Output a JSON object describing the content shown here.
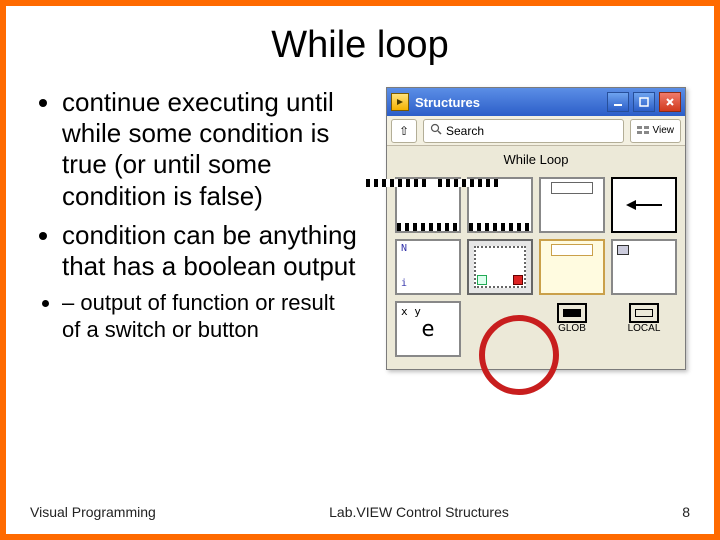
{
  "slide": {
    "title": "While loop",
    "bullets": [
      "continue executing until while some condition is true (or until some condition is false)",
      "condition can be anything that has a boolean output"
    ],
    "sub_bullets": [
      "output of function or result of a switch or button"
    ]
  },
  "palette": {
    "window_title": "Structures",
    "toolbar": {
      "up_glyph": "⇧",
      "search_label": "Search",
      "view_label": "View"
    },
    "section_label": "While Loop",
    "formula_letter": "e",
    "legend": {
      "glob": "GLOB",
      "local": "LOCAL"
    }
  },
  "footer": {
    "left": "Visual Programming",
    "center": "Lab.VIEW Control Structures",
    "page": "8"
  }
}
